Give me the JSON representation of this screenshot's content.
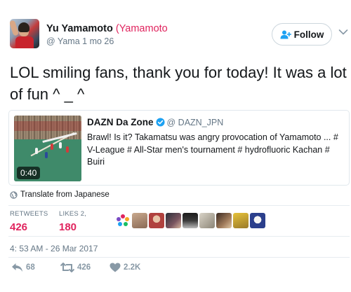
{
  "author": {
    "display_name": "Yu Yamamoto",
    "extra_name": "(Yamamoto",
    "handle": "@ Yama",
    "time_ago": "1 mo 26"
  },
  "follow_button": {
    "label": "Follow"
  },
  "tweet": {
    "text": "LOL smiling fans, thank you for today! It was a lot of fun ^ _ ^"
  },
  "quote": {
    "name": "DAZN Da Zone",
    "handle": "@ DAZN_JPN",
    "text": "Brawl! Is it? Takamatsu was angry provocation of Yamamoto ... # V-League  # All-Star men's tournament  # hydrofluoric Kachan  # Buiri",
    "video_duration": "0:40"
  },
  "translate_label": "Translate from Japanese",
  "stats": {
    "retweets_label": "RETWEETS",
    "retweets_value": "426",
    "likes_label": "LIKES 2,",
    "likes_value": "180"
  },
  "timestamp": "4: 53 AM - 26 Mar 2017",
  "actions": {
    "reply_count": "68",
    "retweet_count": "426",
    "like_count": "2.2K"
  },
  "colors": {
    "accent_pink": "#e0245e",
    "link_blue": "#1da1f2",
    "muted": "#657786",
    "action_gray": "#8899a6"
  },
  "icons": [
    "follow-icon",
    "chevron-down-icon",
    "verified-icon",
    "globe-icon",
    "reply-icon",
    "retweet-icon",
    "heart-icon"
  ]
}
